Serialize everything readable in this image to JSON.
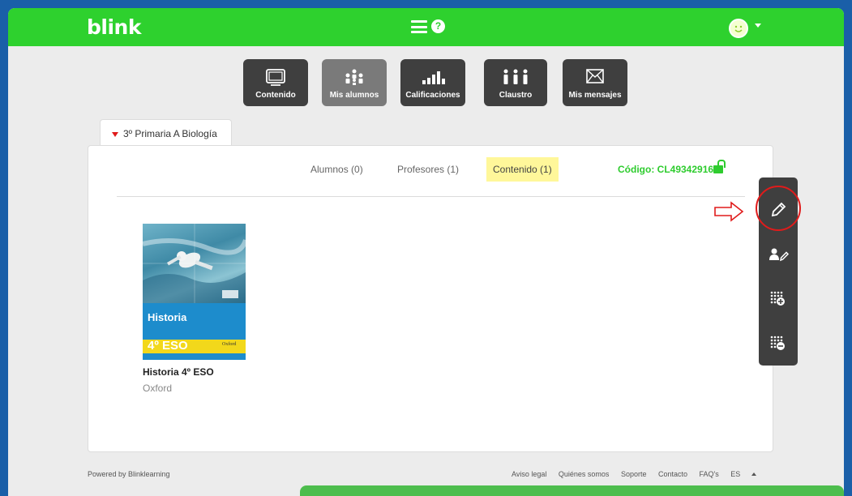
{
  "app": {
    "logo": "blink"
  },
  "topbar": {
    "menu_icon": "menu-icon",
    "help_icon": "help-icon",
    "help_glyph": "?"
  },
  "nav": [
    {
      "label": "Contenido",
      "icon": "content-icon",
      "active": false
    },
    {
      "label": "Mis alumnos",
      "icon": "students-icon",
      "active": true
    },
    {
      "label": "Calificaciones",
      "icon": "grades-icon",
      "active": false
    },
    {
      "label": "Claustro",
      "icon": "staff-icon",
      "active": false
    },
    {
      "label": "Mis mensajes",
      "icon": "mail-icon",
      "active": false
    }
  ],
  "class_tab": {
    "label": "3º Primaria A Biología"
  },
  "subtabs": {
    "alumnos": "Alumnos (0)",
    "profesores": "Profesores (1)",
    "contenido": "Contenido (1)",
    "active": "contenido"
  },
  "class_code": "Código: CL49342916",
  "book": {
    "cover_title": "Historia",
    "cover_level": "4º ESO",
    "cover_publisher": "Oxford",
    "name": "Historia 4º ESO",
    "publisher": "Oxford"
  },
  "side_toolbar": [
    "edit-icon",
    "edit-users-icon",
    "add-grid-icon",
    "remove-grid-icon"
  ],
  "footer": {
    "powered": "Powered by Blinklearning",
    "links": [
      "Aviso legal",
      "Quiénes somos",
      "Soporte",
      "Contacto",
      "FAQ's"
    ],
    "lang": "ES"
  },
  "colors": {
    "brand_green": "#2ed12e",
    "highlight": "#fff79a",
    "annotation_red": "#e01b1b"
  }
}
